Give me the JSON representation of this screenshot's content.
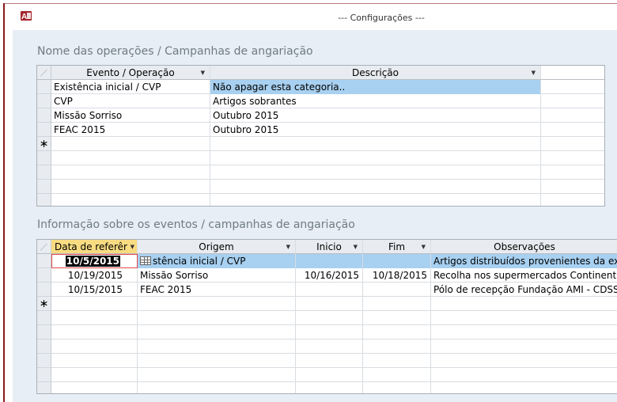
{
  "window": {
    "title": "--- Configurações ---",
    "app_icon": "access-icon",
    "frame_color": "#8b1a1a"
  },
  "section1": {
    "title": "Nome das operações / Campanhas de angariação",
    "columns": [
      "Evento / Operação",
      "Descrição"
    ],
    "rows": [
      {
        "evento": "Existência inicial / CVP",
        "descricao": "Não apagar esta categoria.."
      },
      {
        "evento": "CVP",
        "descricao": "Artigos sobrantes"
      },
      {
        "evento": "Missão Sorriso",
        "descricao": "Outubro 2015"
      },
      {
        "evento": "FEAC 2015",
        "descricao": "Outubro 2015"
      }
    ],
    "new_record_marker": "∗"
  },
  "section2": {
    "title": "Informação sobre os eventos / campanhas de angariação",
    "columns": [
      "Data de referêr",
      "Origem",
      "Inicio",
      "Fim",
      "Observações"
    ],
    "rows": [
      {
        "data": "10/5/2015",
        "origem": "stência inicial / CVP",
        "inicio": "",
        "fim": "",
        "obs": "Artigos distribuídos provenientes da exist"
      },
      {
        "data": "10/19/2015",
        "origem": "Missão Sorriso",
        "inicio": "10/16/2015",
        "fim": "10/18/2015",
        "obs": "Recolha nos supermercados Continente"
      },
      {
        "data": "10/15/2015",
        "origem": "FEAC 2015",
        "inicio": "",
        "fim": "",
        "obs": "Pólo de recepção Fundação AMI - CDSS"
      }
    ],
    "new_record_marker": "∗"
  },
  "colors": {
    "canvas": "#e7eef5",
    "selected_row": "#a8d0f0",
    "sorted_header": "#f9dc82",
    "section_title": "#707b84"
  }
}
